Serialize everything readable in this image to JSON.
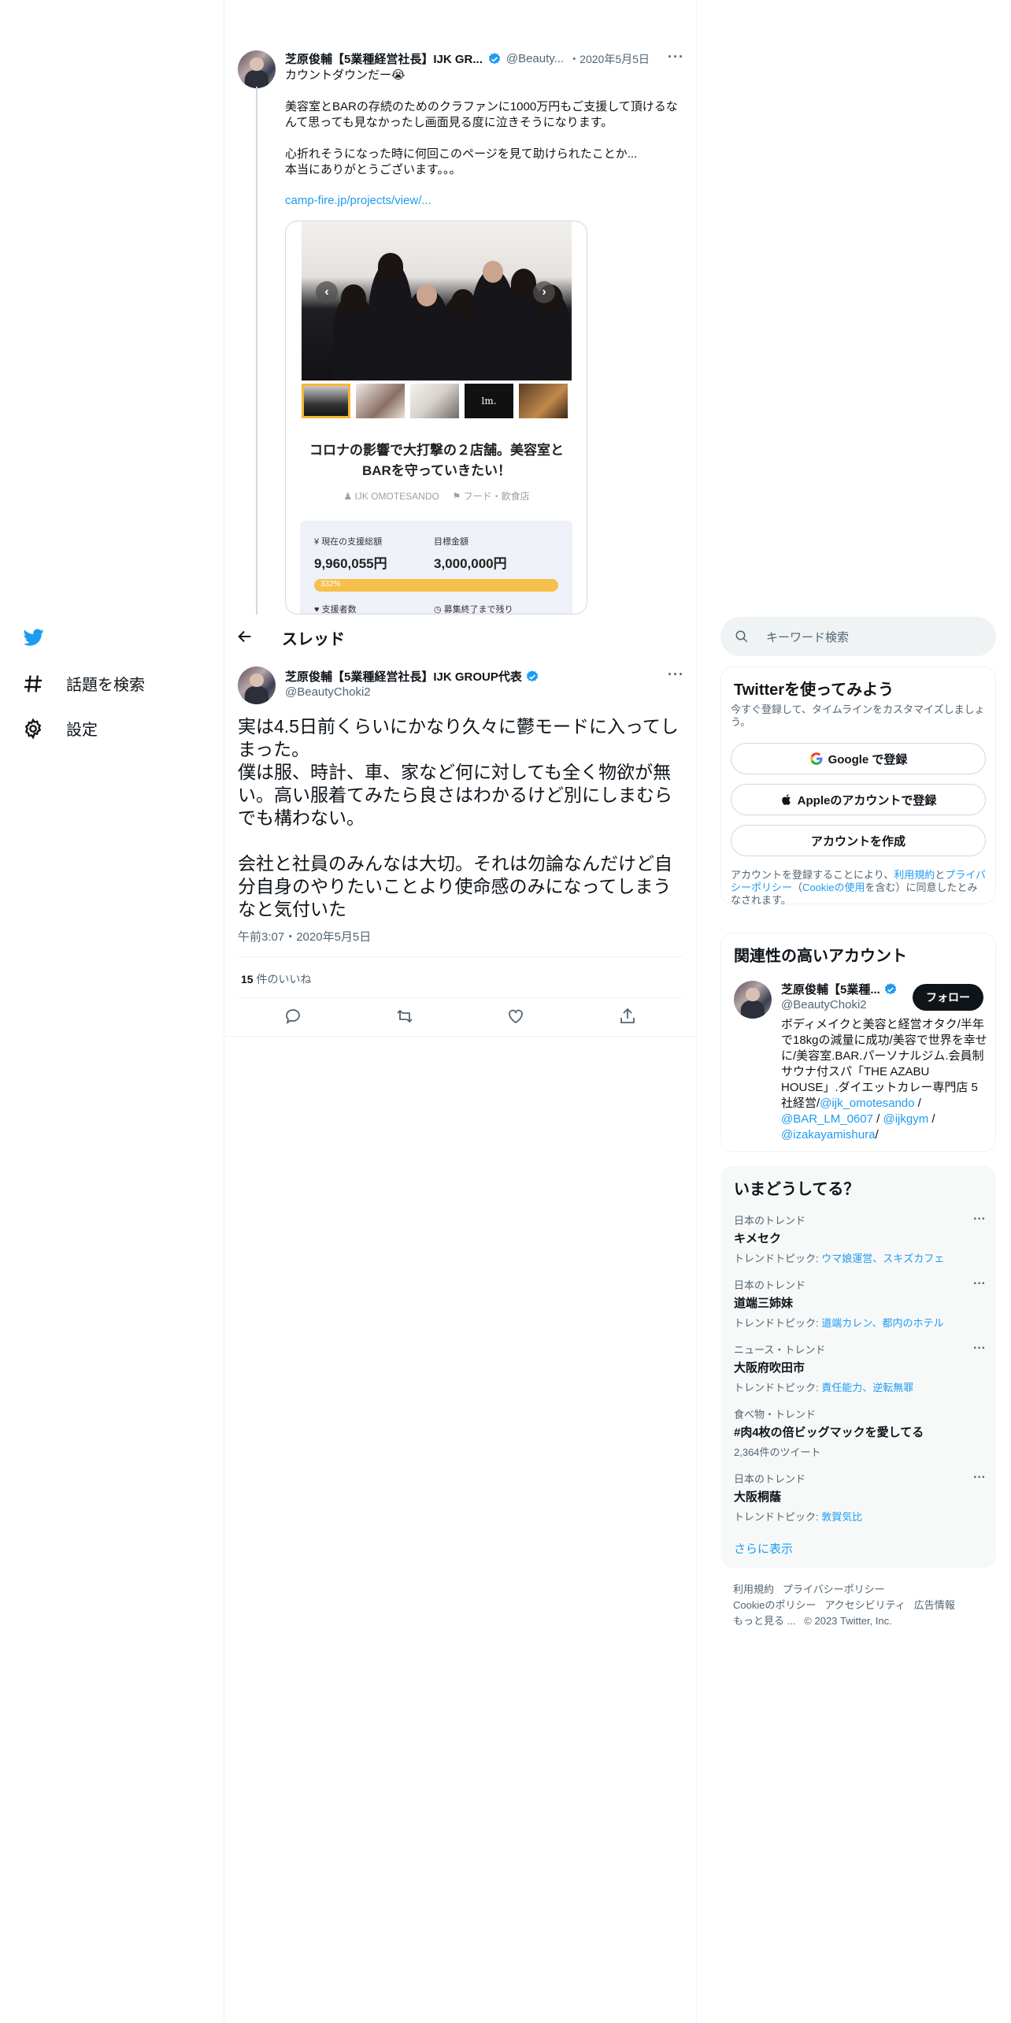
{
  "nav": {
    "explore": "話題を検索",
    "settings": "設定"
  },
  "quoted": {
    "name": "芝原俊輔【5業種経営社長】IJK GR...",
    "handle": "@Beauty...",
    "date": "・2020年5月5日",
    "line1": "カウントダウンだー😭",
    "body1": "美容室とBARの存続のためのクラファンに1000万円もご支援して頂けるなんて思っても見なかったし画面見る度に泣きそうになります。",
    "body2": "心折れそうになった時に何回このページを見て助けられたことか...\n本当にありがとうございます。。。",
    "link": "camp-fire.jp/projects/view/...",
    "card": {
      "title": "コロナの影響で大打撃の２店舗。美容室とBARを守っていきたい！",
      "owner": "IJK OMOTESANDO",
      "category": "フード・飲食店",
      "current_label": "現在の支援総額",
      "current_value": "9,960,055円",
      "goal_label": "目標金額",
      "goal_value": "3,000,000円",
      "percent": "332%",
      "progress_fraction": 1.0,
      "supporters_label": "支援者数",
      "remaining_label": "募集終了まで残り"
    }
  },
  "header": {
    "title": "スレッド"
  },
  "main": {
    "name": "芝原俊輔【5業種経営社長】IJK GROUP代表",
    "handle": "@BeautyChoki2",
    "text": "実は4.5日前くらいにかなり久々に鬱モードに入ってしまった。\n僕は服、時計、車、家など何に対しても全く物欲が無い。高い服着てみたら良さはわかるけど別にしまむらでも構わない。\n\n会社と社員のみんなは大切。それは勿論なんだけど自分自身のやりたいことより使命感のみになってしまうなと気付いた",
    "timestamp": "午前3:07・2020年5月5日",
    "likes_count": "15",
    "likes_label": "件のいいね"
  },
  "search": {
    "placeholder": "キーワード検索"
  },
  "signup": {
    "title": "Twitterを使ってみよう",
    "desc": "今すぐ登録して、タイムラインをカスタマイズしましょう。",
    "google": "Google で登録",
    "apple": "Appleのアカウントで登録",
    "create": "アカウントを作成",
    "legal_pre": "アカウントを登録することにより、",
    "legal_terms": "利用規約",
    "legal_and": "と",
    "legal_privacy": "プライバシーポリシー",
    "legal_mid": "（",
    "legal_cookie": "Cookieの使用",
    "legal_post": "を含む）に同意したとみなされます。"
  },
  "related": {
    "title": "関連性の高いアカウント",
    "name": "芝原俊輔【5業種...",
    "handle": "@BeautyChoki2",
    "follow": "フォロー",
    "bio": "ボディメイクと美容と経営オタク/半年で18kgの減量に成功/美容で世界を幸せに/美容室.BAR.パーソナルジム.会員制サウナ付スパ「THE AZABU HOUSE」.ダイエットカレー専門店 5社経営/",
    "mention1": "@ijk_omotesando",
    "sep1": " /",
    "mention2": "@BAR_LM_0607",
    "sep2": " /",
    "mention3": "@ijkgym",
    "sep3": " /",
    "mention4": "@izakayamishura",
    "sep4": "/"
  },
  "trends": {
    "title": "いまどうしてる？",
    "items": [
      {
        "context": "日本のトレンド",
        "title": "キメセク",
        "sub_label": "トレンドトピック: ",
        "sub_link": "ウマ娘運営、スキズカフェ"
      },
      {
        "context": "日本のトレンド",
        "title": "道端三姉妹",
        "sub_label": "トレンドトピック: ",
        "sub_link": "道端カレン、都内のホテル"
      },
      {
        "context": "ニュース・トレンド",
        "title": "大阪府吹田市",
        "sub_label": "トレンドトピック: ",
        "sub_link": "責任能力、逆転無罪"
      },
      {
        "context": "食べ物・トレンド",
        "title": "#肉4枚の倍ビッグマックを愛してる",
        "sub_label": "2,364件のツイート",
        "sub_link": ""
      },
      {
        "context": "日本のトレンド",
        "title": "大阪桐蔭",
        "sub_label": "トレンドトピック: ",
        "sub_link": "敦賀気比"
      }
    ],
    "more": "さらに表示"
  },
  "footer": {
    "line1a": "利用規約",
    "line1b": "プライバシーポリシー",
    "line2a": "Cookieのポリシー",
    "line2b": "アクセシビリティ",
    "line2c": "広告情報",
    "line3a": "もっと見る ...",
    "line3b": "© 2023 Twitter, Inc."
  },
  "colors": {
    "accent": "#1d9bf0",
    "text": "#0f1419",
    "muted": "#536471",
    "progress": "#f6c04a"
  }
}
